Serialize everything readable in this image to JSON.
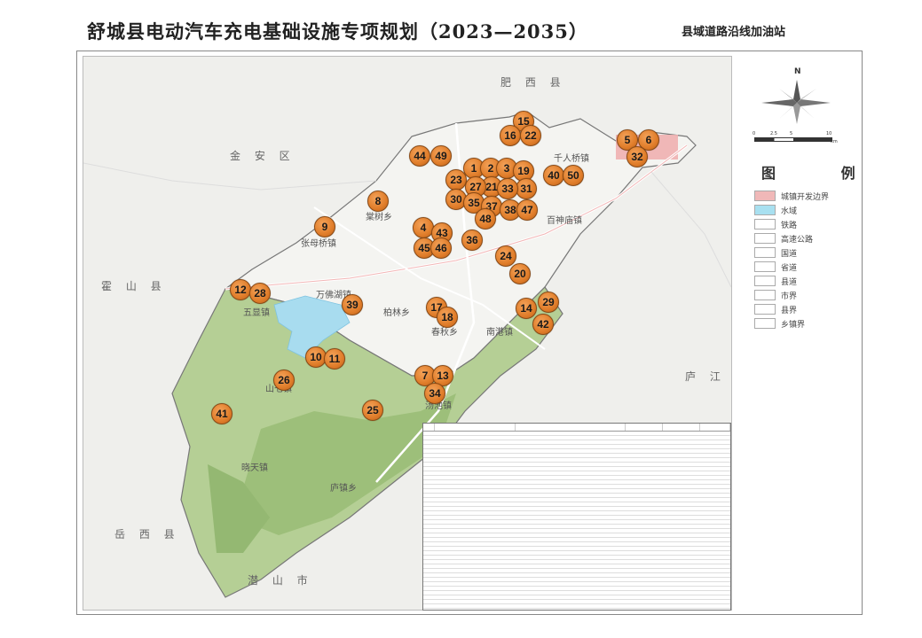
{
  "header": {
    "title": "舒城县电动汽车充电基础设施专项规划（2023—2035）",
    "subtitle": "县域道路沿线加油站"
  },
  "map": {
    "region_labels": [
      "肥 西 县",
      "金 安 区",
      "霍 山 县",
      "庐 江 县",
      "岳 西 县",
      "潜 山 市"
    ],
    "town_labels": [
      "千人桥镇",
      "棠树乡",
      "张母桥镇",
      "万佛湖镇",
      "五显镇",
      "柏林乡",
      "汤池镇",
      "庐镇乡",
      "春秋乡",
      "南港镇",
      "百神庙镇",
      "晓天镇",
      "山七镇"
    ],
    "stations": [
      "1",
      "2",
      "3",
      "4",
      "5",
      "6",
      "7",
      "8",
      "9",
      "10",
      "11",
      "12",
      "13",
      "14",
      "15",
      "16",
      "17",
      "18",
      "19",
      "20",
      "21",
      "22",
      "23",
      "24",
      "25",
      "26",
      "27",
      "28",
      "29",
      "30",
      "31",
      "32",
      "33",
      "34",
      "35",
      "36",
      "37",
      "38",
      "39",
      "40",
      "41",
      "42",
      "43",
      "44",
      "45",
      "46",
      "47",
      "48",
      "49",
      "50"
    ]
  },
  "compass": {
    "north": "N"
  },
  "scale": {
    "ticks": [
      "0",
      "2.5",
      "5",
      "10"
    ],
    "unit": "km"
  },
  "legend": {
    "title": "图 例",
    "items": [
      {
        "label": "城镇开发边界",
        "color": "#f0b8b8"
      },
      {
        "label": "水域",
        "color": "#a8e0f0"
      },
      {
        "label": "铁路",
        "color": "#ffffff"
      },
      {
        "label": "高速公路",
        "color": "#ffffff"
      },
      {
        "label": "国道",
        "color": "#ffffff"
      },
      {
        "label": "省道",
        "color": "#ffffff"
      },
      {
        "label": "县道",
        "color": "#ffffff"
      },
      {
        "label": "市界",
        "color": "#ffffff"
      },
      {
        "label": "县界",
        "color": "#ffffff"
      },
      {
        "label": "乡镇界",
        "color": "#ffffff"
      }
    ]
  },
  "colors": {
    "marker": "#e07d2a",
    "water": "#a8dcef",
    "urban": "#f0b0b0",
    "forest": "#a9c88a",
    "plain": "#f2f2ef"
  }
}
